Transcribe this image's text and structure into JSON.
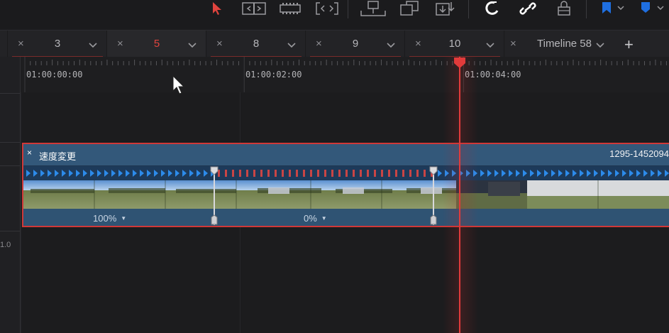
{
  "toolbar": {
    "tools": [
      {
        "name": "selection-arrow-icon"
      },
      {
        "name": "trim-edit-icon"
      },
      {
        "name": "dynamic-trim-icon"
      },
      {
        "name": "blade-edit-icon"
      },
      {
        "name": "insert-clip-icon"
      },
      {
        "name": "overwrite-clip-icon"
      },
      {
        "name": "replace-clip-icon"
      },
      {
        "name": "snapping-magnet-icon"
      },
      {
        "name": "linked-selection-icon"
      },
      {
        "name": "position-lock-icon"
      },
      {
        "name": "flag-icon"
      },
      {
        "name": "marker-icon"
      }
    ],
    "accent_active": "#e0443e",
    "flag_color": "#1f6fe0"
  },
  "tabs": [
    {
      "label": "3",
      "active": false
    },
    {
      "label": "5",
      "active": true
    },
    {
      "label": "8",
      "active": false
    },
    {
      "label": "9",
      "active": false
    },
    {
      "label": "10",
      "active": false
    },
    {
      "label": "Timeline 58",
      "active": false
    }
  ],
  "add_tab_label": "+",
  "ruler": {
    "timecodes": [
      "01:00:00:00",
      "01:00:02:00",
      "01:00:04:00"
    ]
  },
  "clip": {
    "close_glyph": "×",
    "title": "速度変更",
    "source_id": "1295-1452094",
    "segments": [
      {
        "speed_label": "100%"
      },
      {
        "speed_label": "0%"
      }
    ],
    "border_color": "#d03838",
    "fill_color": "#2d4f6e"
  },
  "track2": {
    "label": "1.0"
  },
  "playhead": {
    "color": "#e23b3b"
  }
}
